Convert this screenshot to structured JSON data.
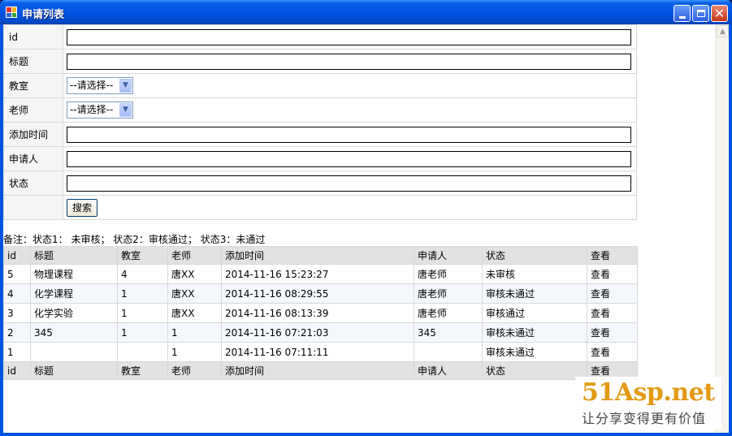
{
  "window": {
    "title": "申请列表"
  },
  "form": {
    "fields": [
      {
        "label": "id",
        "type": "text",
        "value": ""
      },
      {
        "label": "标题",
        "type": "text",
        "value": ""
      },
      {
        "label": "教室",
        "type": "select",
        "value": "--请选择--"
      },
      {
        "label": "老师",
        "type": "select",
        "value": "--请选择--"
      },
      {
        "label": "添加时间",
        "type": "text",
        "value": ""
      },
      {
        "label": "申请人",
        "type": "text",
        "value": ""
      },
      {
        "label": "状态",
        "type": "text",
        "value": ""
      }
    ],
    "search_label": "搜索"
  },
  "note": "备注：状态1： 未审核； 状态2：审核通过； 状态3：未通过",
  "table": {
    "columns": [
      "id",
      "标题",
      "教室",
      "老师",
      "添加时间",
      "申请人",
      "状态",
      "查看"
    ],
    "rows": [
      [
        "5",
        "物理课程",
        "4",
        "唐XX",
        "2014-11-16 15:23:27",
        "唐老师",
        "未审核",
        "查看"
      ],
      [
        "4",
        "化学课程",
        "1",
        "唐XX",
        "2014-11-16 08:29:55",
        "唐老师",
        "审核未通过",
        "查看"
      ],
      [
        "3",
        "化学实验",
        "1",
        "唐XX",
        "2014-11-16 08:13:39",
        "唐老师",
        "审核通过",
        "查看"
      ],
      [
        "2",
        "345",
        "1",
        "1",
        "2014-11-16 07:21:03",
        "345",
        "审核未通过",
        "查看"
      ],
      [
        "1",
        "",
        "",
        "1",
        "2014-11-16 07:11:11",
        "",
        "审核未通过",
        "查看"
      ]
    ]
  },
  "watermark": {
    "logo": "51Asp.net",
    "slogan": "让分享变得更有价值"
  },
  "colors": {
    "titlebar": "#0054e3",
    "header_row": "#e2e2e2",
    "watermark": "#e39a12"
  }
}
